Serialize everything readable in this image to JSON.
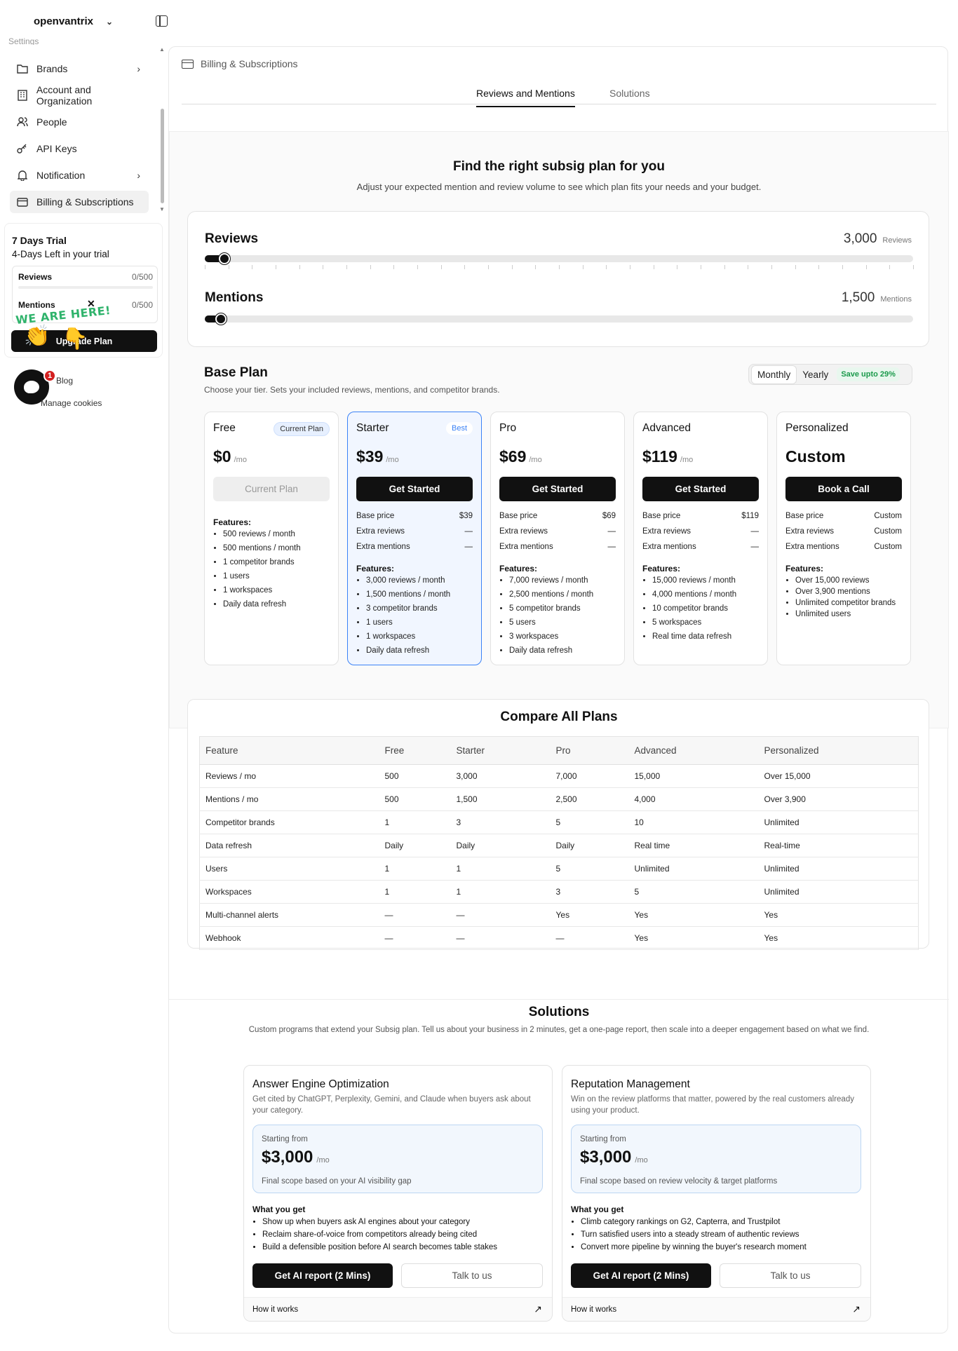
{
  "sidebar": {
    "org": "openvantrix",
    "settings_label": "Settings",
    "items": [
      {
        "label": "Brands",
        "icon": "folder-icon",
        "arrow": true
      },
      {
        "label": "Account and Organization",
        "icon": "building-icon",
        "arrow": false
      },
      {
        "label": "People",
        "icon": "users-icon",
        "arrow": false
      },
      {
        "label": "API Keys",
        "icon": "key-icon",
        "arrow": false
      },
      {
        "label": "Notification",
        "icon": "bell-icon",
        "arrow": true
      },
      {
        "label": "Billing & Subscriptions",
        "icon": "credit-card-icon",
        "arrow": false
      }
    ],
    "trial": {
      "title": "7 Days Trial",
      "subtitle": "4-Days Left in your trial",
      "reviews_label": "Reviews",
      "reviews_value": "0/500",
      "mentions_label": "Mentions",
      "mentions_value": "0/500",
      "close": "✕",
      "promo": "WE ARE HERE!",
      "upgrade": "Upgrade Plan"
    },
    "footer": {
      "link1": "Blog",
      "link2": "Manage cookies"
    },
    "chat_badge": "1"
  },
  "main": {
    "breadcrumb": "Billing & Subscriptions",
    "tabs": [
      "Reviews and Mentions",
      "Solutions"
    ],
    "heading": "Find the right subsig plan for you",
    "subheading": "Adjust your expected mention and review volume to see which plan fits your needs and your budget.",
    "sliders": {
      "reviews": {
        "label": "Reviews",
        "value": "3,000",
        "unit": "Reviews",
        "fraction": 0.02
      },
      "mentions": {
        "label": "Mentions",
        "value": "1,500",
        "unit": "Mentions",
        "fraction": 0.015
      }
    },
    "base_plan": {
      "title": "Base Plan",
      "subtitle": "Choose your tier. Sets your included reviews, mentions, and competitor brands.",
      "billing": {
        "monthly": "Monthly",
        "yearly": "Yearly",
        "save": "Save upto 29%"
      }
    },
    "plans": [
      {
        "name": "Free",
        "badge": "Current Plan",
        "price": "$0",
        "per": "/mo",
        "button": "Current Plan",
        "features_label": "Features:",
        "features": [
          "500 reviews / month",
          "500 mentions / month",
          "1 competitor brands",
          "1 users",
          "1 workspaces",
          "Daily data refresh"
        ]
      },
      {
        "name": "Starter",
        "badge": "Best",
        "price": "$39",
        "per": "/mo",
        "button": "Get Started",
        "rows": [
          [
            "Base price",
            "$39"
          ],
          [
            "Extra reviews",
            "—"
          ],
          [
            "Extra mentions",
            "—"
          ]
        ],
        "features_label": "Features:",
        "features": [
          "3,000 reviews / month",
          "1,500 mentions / month",
          "3 competitor brands",
          "1 users",
          "1 workspaces",
          "Daily data refresh"
        ]
      },
      {
        "name": "Pro",
        "price": "$69",
        "per": "/mo",
        "button": "Get Started",
        "rows": [
          [
            "Base price",
            "$69"
          ],
          [
            "Extra reviews",
            "—"
          ],
          [
            "Extra mentions",
            "—"
          ]
        ],
        "features_label": "Features:",
        "features": [
          "7,000 reviews / month",
          "2,500 mentions / month",
          "5 competitor brands",
          "5 users",
          "3 workspaces",
          "Daily data refresh"
        ]
      },
      {
        "name": "Advanced",
        "price": "$119",
        "per": "/mo",
        "button": "Get Started",
        "rows": [
          [
            "Base price",
            "$119"
          ],
          [
            "Extra reviews",
            "—"
          ],
          [
            "Extra mentions",
            "—"
          ]
        ],
        "features_label": "Features:",
        "features": [
          "15,000 reviews / month",
          "4,000 mentions / month",
          "10 competitor brands",
          "5 workspaces",
          "Real time data refresh"
        ]
      },
      {
        "name": "Personalized",
        "price": "Custom",
        "button": "Book a Call",
        "rows": [
          [
            "Base price",
            "Custom"
          ],
          [
            "Extra reviews",
            "Custom"
          ],
          [
            "Extra mentions",
            "Custom"
          ]
        ],
        "features_label": "Features:",
        "features": [
          "Over 15,000 reviews",
          "Over 3,900 mentions",
          "Unlimited competitor brands",
          "Unlimited users"
        ]
      }
    ],
    "compare": {
      "title": "Compare All Plans",
      "headers": [
        "Feature",
        "Free",
        "Starter",
        "Pro",
        "Advanced",
        "Personalized"
      ],
      "rows": [
        [
          "Reviews / mo",
          "500",
          "3,000",
          "7,000",
          "15,000",
          "Over 15,000"
        ],
        [
          "Mentions / mo",
          "500",
          "1,500",
          "2,500",
          "4,000",
          "Over 3,900"
        ],
        [
          "Competitor brands",
          "1",
          "3",
          "5",
          "10",
          "Unlimited"
        ],
        [
          "Data refresh",
          "Daily",
          "Daily",
          "Daily",
          "Real time",
          "Real-time"
        ],
        [
          "Users",
          "1",
          "1",
          "5",
          "Unlimited",
          "Unlimited"
        ],
        [
          "Workspaces",
          "1",
          "1",
          "3",
          "5",
          "Unlimited"
        ],
        [
          "Multi-channel alerts",
          "—",
          "—",
          "Yes",
          "Yes",
          "Yes"
        ],
        [
          "Webhook",
          "—",
          "—",
          "—",
          "Yes",
          "Yes"
        ]
      ]
    },
    "solutions": {
      "title": "Solutions",
      "subtitle": "Custom programs that extend your Subsig plan. Tell us about your business in 2 minutes, get a one-page report, then scale into a deeper engagement based on what we find.",
      "cards": [
        {
          "title": "Answer Engine Optimization",
          "desc": "Get cited by ChatGPT, Perplexity, Gemini, and Claude when buyers ask about your category.",
          "starting": "Starting from",
          "price": "$3,000",
          "per": "/mo",
          "scope": "Final scope based on your AI visibility gap",
          "wyg": "What you get",
          "items": [
            "Show up when buyers ask AI engines about your category",
            "Reclaim share-of-voice from competitors already being cited",
            "Build a defensible position before AI search becomes table stakes"
          ],
          "primary": "Get AI report (2 Mins)",
          "secondary": "Talk to us",
          "how": "How it works"
        },
        {
          "title": "Reputation Management",
          "desc": "Win on the review platforms that matter, powered by the real customers already using your product.",
          "starting": "Starting from",
          "price": "$3,000",
          "per": "/mo",
          "scope": "Final scope based on review velocity & target platforms",
          "wyg": "What you get",
          "items": [
            "Climb category rankings on G2, Capterra, and Trustpilot",
            "Turn satisfied users into a steady stream of authentic reviews",
            "Convert more pipeline by winning the buyer's research moment"
          ],
          "primary": "Get AI report (2 Mins)",
          "secondary": "Talk to us",
          "how": "How it works"
        }
      ]
    }
  }
}
